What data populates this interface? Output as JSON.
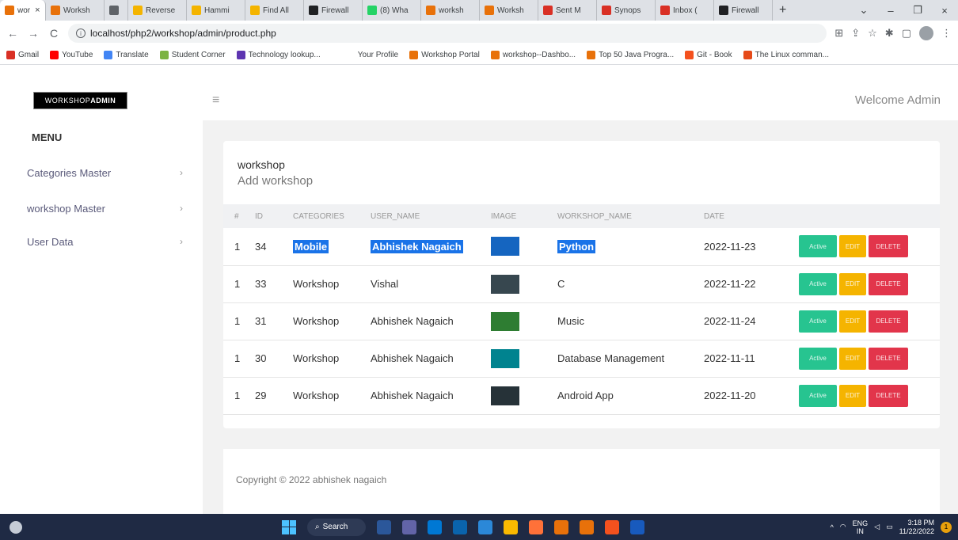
{
  "browser": {
    "tabs": [
      {
        "label": "wor",
        "color": "#e8710a",
        "active": true
      },
      {
        "label": "Worksh",
        "color": "#e8710a"
      },
      {
        "label": "",
        "color": "#5f6368"
      },
      {
        "label": "Reverse",
        "color": "#f4b400"
      },
      {
        "label": "Hammi",
        "color": "#f4b400"
      },
      {
        "label": "Find All",
        "color": "#f4b400"
      },
      {
        "label": "Firewall",
        "color": "#202124"
      },
      {
        "label": "(8) Wha",
        "color": "#25d366"
      },
      {
        "label": "worksh",
        "color": "#e8710a"
      },
      {
        "label": "Worksh",
        "color": "#e8710a"
      },
      {
        "label": "Sent M",
        "color": "#d93025"
      },
      {
        "label": "Synops",
        "color": "#d93025"
      },
      {
        "label": "Inbox (",
        "color": "#d93025"
      },
      {
        "label": "Firewall",
        "color": "#202124"
      }
    ],
    "url": "localhost/php2/workshop/admin/product.php",
    "bookmarks": [
      {
        "label": "Gmail",
        "color": "#d93025"
      },
      {
        "label": "YouTube",
        "color": "#ff0000"
      },
      {
        "label": "Translate",
        "color": "#4285f4"
      },
      {
        "label": "Student Corner",
        "color": "#7cb342"
      },
      {
        "label": "Technology lookup...",
        "color": "#5e35b1"
      },
      {
        "label": "Your Profile",
        "color": "#ffffff"
      },
      {
        "label": "Workshop Portal",
        "color": "#e8710a"
      },
      {
        "label": "workshop--Dashbo...",
        "color": "#e8710a"
      },
      {
        "label": "Top 50 Java Progra...",
        "color": "#e8710a"
      },
      {
        "label": "Git - Book",
        "color": "#f4511e"
      },
      {
        "label": "The Linux comman...",
        "color": "#e64a19"
      }
    ]
  },
  "app": {
    "brand_light": "WORKSHOP",
    "brand_bold": "ADMIN",
    "welcome": "Welcome Admin",
    "menu_title": "MENU",
    "menu": [
      {
        "label": "Categories Master"
      },
      {
        "label": "workshop Master"
      },
      {
        "label": "User Data"
      }
    ],
    "card": {
      "title": "workshop",
      "subtitle": "Add workshop",
      "headers": [
        "#",
        "ID",
        "CATEGORIES",
        "USER_NAME",
        "IMAGE",
        "WORKSHOP_NAME",
        "DATE"
      ],
      "rows": [
        {
          "num": "1",
          "id": "34",
          "category": "Mobile",
          "user": "Abhishek Nagaich",
          "thumb_color": "#1565c0",
          "name": "Python",
          "date": "2022-11-23",
          "highlight": true
        },
        {
          "num": "1",
          "id": "33",
          "category": "Workshop",
          "user": "Vishal",
          "thumb_color": "#37474f",
          "name": "C",
          "date": "2022-11-22"
        },
        {
          "num": "1",
          "id": "31",
          "category": "Workshop",
          "user": "Abhishek Nagaich",
          "thumb_color": "#2e7d32",
          "name": "Music",
          "date": "2022-11-24"
        },
        {
          "num": "1",
          "id": "30",
          "category": "Workshop",
          "user": "Abhishek Nagaich",
          "thumb_color": "#00838f",
          "name": "Database Management",
          "date": "2022-11-11"
        },
        {
          "num": "1",
          "id": "29",
          "category": "Workshop",
          "user": "Abhishek Nagaich",
          "thumb_color": "#263238",
          "name": "Android App",
          "date": "2022-11-20"
        }
      ],
      "btn_active": "Active",
      "btn_edit": "EDIT",
      "btn_delete": "DELETE"
    },
    "footer": "Copyright © 2022 abhishek nagaich"
  },
  "taskbar": {
    "search": "Search",
    "lang1": "ENG",
    "lang2": "IN",
    "time": "3:18 PM",
    "date": "11/22/2022",
    "notifications": "1",
    "apps": [
      "#2b579a",
      "#6264a7",
      "#0078d4",
      "#0a64ad",
      "#2b88d8",
      "#f9b900",
      "#ff7139",
      "#e8710a",
      "#e8710a",
      "#f4511e",
      "#185abd"
    ]
  },
  "colors": {
    "active": "#27c490",
    "edit": "#f5b400",
    "delete": "#e2354b",
    "highlight": "#1a73e8"
  }
}
